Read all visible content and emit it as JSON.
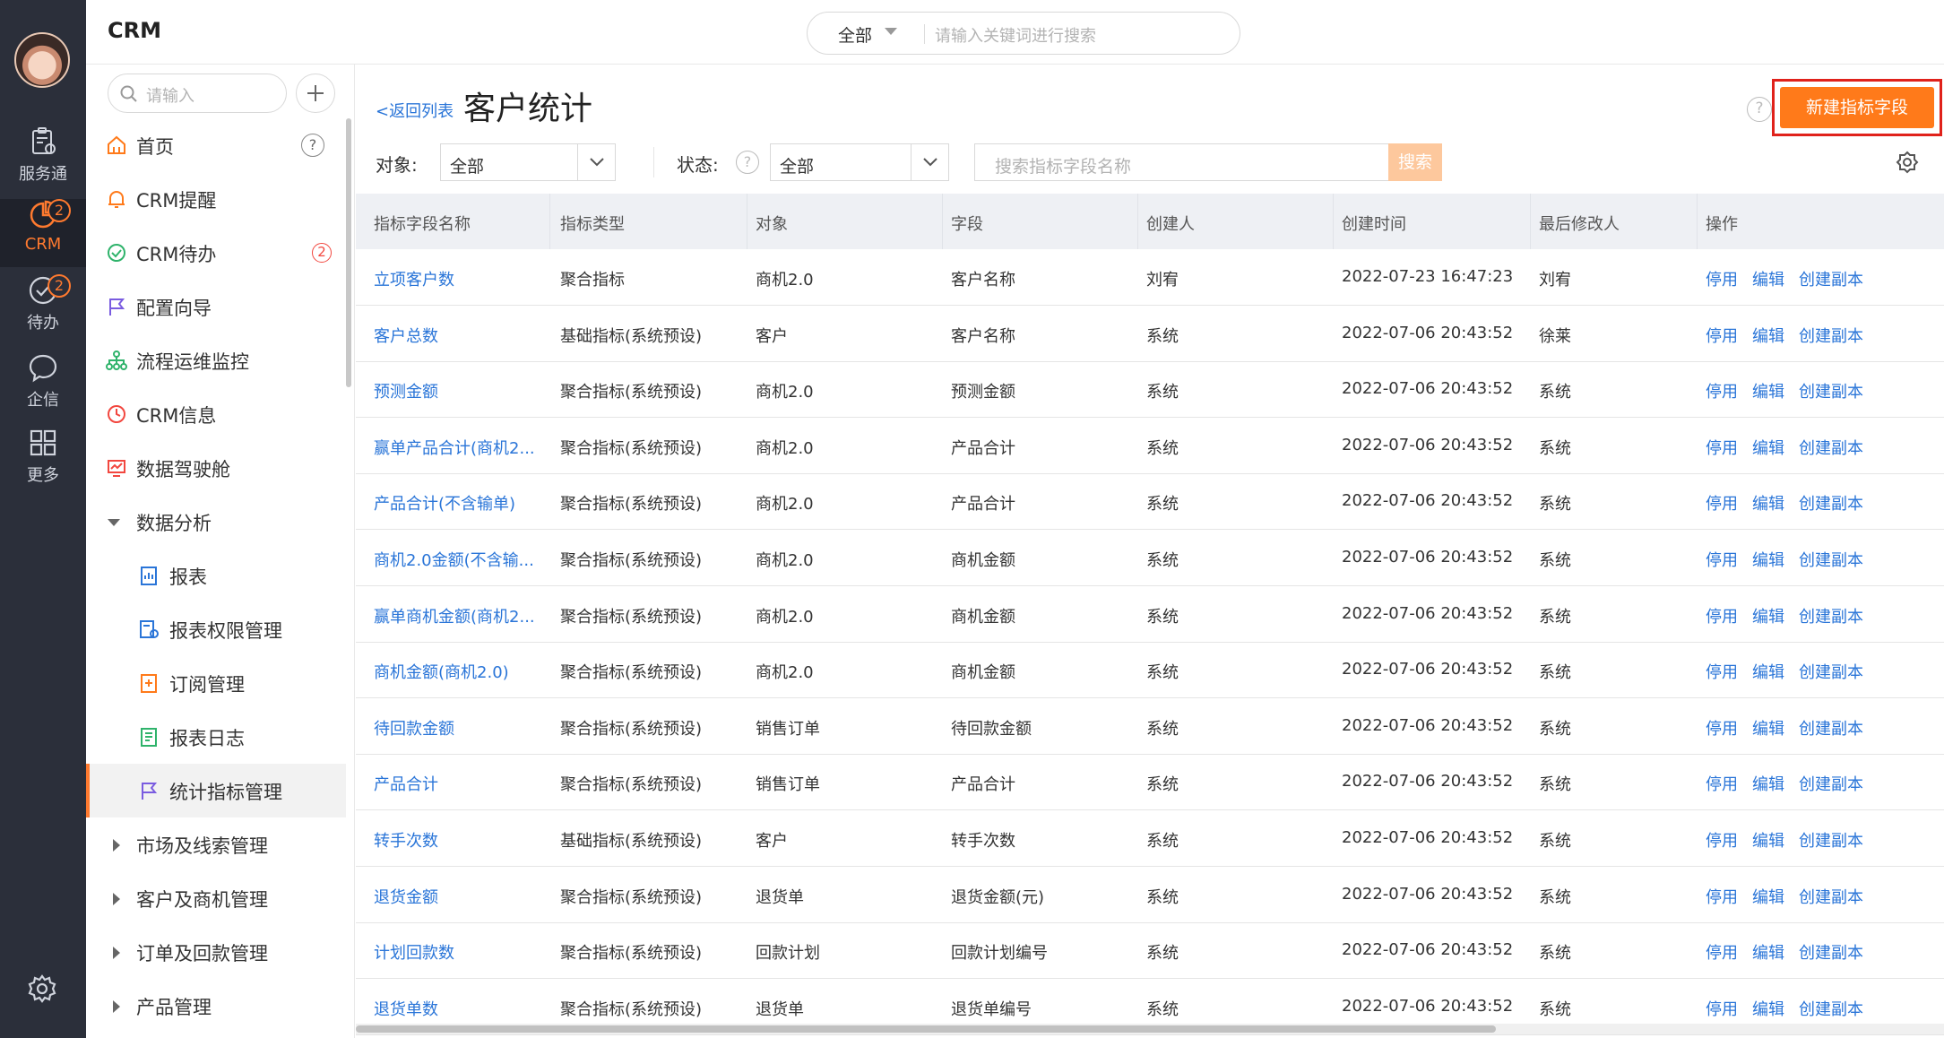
{
  "rail": {
    "items": [
      {
        "label": "服务通",
        "icon": "clipboard-heart-icon"
      },
      {
        "label": "CRM",
        "icon": "pie-chart-icon",
        "badge": "2",
        "active": true
      },
      {
        "label": "待办",
        "icon": "check-circle-icon",
        "badge": "2"
      },
      {
        "label": "企信",
        "icon": "chat-bubble-icon"
      },
      {
        "label": "更多",
        "icon": "grid-icon"
      }
    ],
    "settings_icon": "gear-icon"
  },
  "header": {
    "app_title": "CRM",
    "search_scope": "全部",
    "search_placeholder": "请输入关键词进行搜索"
  },
  "sidebar": {
    "search_placeholder": "请输入",
    "items": [
      {
        "label": "首页",
        "icon": "home-icon",
        "help": "?"
      },
      {
        "label": "CRM提醒",
        "icon": "bell-icon"
      },
      {
        "label": "CRM待办",
        "icon": "check-circle-icon",
        "badge": "2"
      },
      {
        "label": "配置向导",
        "icon": "flag-icon"
      },
      {
        "label": "流程运维监控",
        "icon": "org-tree-icon"
      },
      {
        "label": "CRM信息",
        "icon": "clock-icon"
      },
      {
        "label": "数据驾驶舱",
        "icon": "monitor-icon"
      },
      {
        "label": "数据分析",
        "expanded": true
      },
      {
        "label": "报表",
        "icon": "report-icon",
        "sub": true
      },
      {
        "label": "报表权限管理",
        "icon": "report-lock-icon",
        "sub": true
      },
      {
        "label": "订阅管理",
        "icon": "subscribe-icon",
        "sub": true
      },
      {
        "label": "报表日志",
        "icon": "log-icon",
        "sub": true
      },
      {
        "label": "统计指标管理",
        "icon": "flag-icon",
        "sub": true,
        "selected": true
      },
      {
        "label": "市场及线索管理",
        "collapsed": true
      },
      {
        "label": "客户及商机管理",
        "collapsed": true
      },
      {
        "label": "订单及回款管理",
        "collapsed": true
      },
      {
        "label": "产品管理",
        "collapsed": true
      }
    ]
  },
  "main": {
    "back_link": "<返回列表",
    "title": "客户统计",
    "help": "?",
    "new_button": "新建指标字段",
    "filters": {
      "object_label": "对象:",
      "object_value": "全部",
      "status_label": "状态:",
      "status_help": "?",
      "status_value": "全部",
      "search_placeholder": "搜索指标字段名称",
      "search_button": "搜索"
    },
    "table": {
      "columns": [
        "指标字段名称",
        "指标类型",
        "对象",
        "字段",
        "创建人",
        "创建时间",
        "最后修改人",
        "操作"
      ],
      "actions": [
        "停用",
        "编辑",
        "创建副本"
      ],
      "rows": [
        [
          "立项客户数",
          "聚合指标",
          "商机2.0",
          "客户名称",
          "刘宥",
          "2022-07-23 16:47:23",
          "刘宥"
        ],
        [
          "客户总数",
          "基础指标(系统预设)",
          "客户",
          "客户名称",
          "系统",
          "2022-07-06 20:43:52",
          "徐莱"
        ],
        [
          "预测金额",
          "聚合指标(系统预设)",
          "商机2.0",
          "预测金额",
          "系统",
          "2022-07-06 20:43:52",
          "系统"
        ],
        [
          "赢单产品合计(商机2...",
          "聚合指标(系统预设)",
          "商机2.0",
          "产品合计",
          "系统",
          "2022-07-06 20:43:52",
          "系统"
        ],
        [
          "产品合计(不含输单)",
          "聚合指标(系统预设)",
          "商机2.0",
          "产品合计",
          "系统",
          "2022-07-06 20:43:52",
          "系统"
        ],
        [
          "商机2.0金额(不含输...",
          "聚合指标(系统预设)",
          "商机2.0",
          "商机金额",
          "系统",
          "2022-07-06 20:43:52",
          "系统"
        ],
        [
          "赢单商机金额(商机2...",
          "聚合指标(系统预设)",
          "商机2.0",
          "商机金额",
          "系统",
          "2022-07-06 20:43:52",
          "系统"
        ],
        [
          "商机金额(商机2.0)",
          "聚合指标(系统预设)",
          "商机2.0",
          "商机金额",
          "系统",
          "2022-07-06 20:43:52",
          "系统"
        ],
        [
          "待回款金额",
          "聚合指标(系统预设)",
          "销售订单",
          "待回款金额",
          "系统",
          "2022-07-06 20:43:52",
          "系统"
        ],
        [
          "产品合计",
          "聚合指标(系统预设)",
          "销售订单",
          "产品合计",
          "系统",
          "2022-07-06 20:43:52",
          "系统"
        ],
        [
          "转手次数",
          "基础指标(系统预设)",
          "客户",
          "转手次数",
          "系统",
          "2022-07-06 20:43:52",
          "系统"
        ],
        [
          "退货金额",
          "聚合指标(系统预设)",
          "退货单",
          "退货金额(元)",
          "系统",
          "2022-07-06 20:43:52",
          "系统"
        ],
        [
          "计划回款数",
          "聚合指标(系统预设)",
          "回款计划",
          "回款计划编号",
          "系统",
          "2022-07-06 20:43:52",
          "系统"
        ],
        [
          "退货单数",
          "聚合指标(系统预设)",
          "退货单",
          "退货单编号",
          "系统",
          "2022-07-06 20:43:52",
          "系统"
        ]
      ]
    }
  },
  "colors": {
    "accent": "#ff7a1a",
    "link": "#2a75d8",
    "rail_bg": "#2b2f3a",
    "highlight_frame": "#e0221b"
  }
}
